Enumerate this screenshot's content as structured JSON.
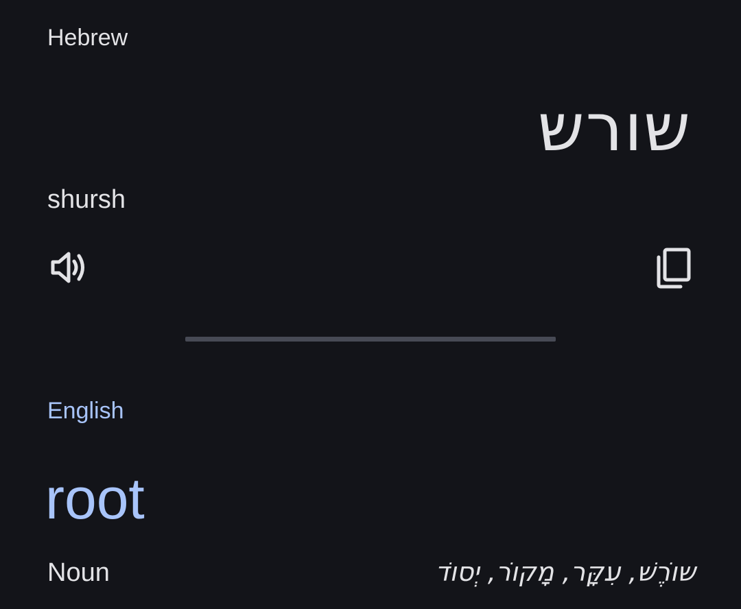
{
  "source": {
    "language": "Hebrew",
    "text": "שורש",
    "transliteration": "shursh"
  },
  "actions": {
    "speaker_icon": "volume-up-icon",
    "copy_icon": "copy-icon"
  },
  "target": {
    "language": "English",
    "text": "root",
    "part_of_speech": "Noun",
    "reverse_translations": "שוֹרֶשׁ, עִקָּר, מָקוֹר, יְסוֹד"
  },
  "colors": {
    "background": "#131419",
    "text": "#e3e3e6",
    "accent": "#a8c4fa",
    "divider": "#474a55"
  }
}
